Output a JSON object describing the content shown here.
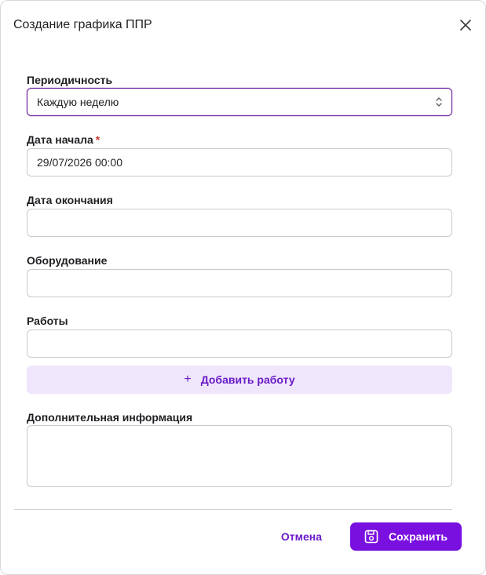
{
  "dialog": {
    "title": "Создание графика ППР",
    "close_icon": "close-icon"
  },
  "form": {
    "periodicity": {
      "label": "Периодичность",
      "value": "Каждую неделю",
      "icon": "chevron-up-down-icon"
    },
    "start_date": {
      "label": "Дата начала",
      "required_mark": "*",
      "value": "29/07/2026 00:00"
    },
    "end_date": {
      "label": "Дата окончания",
      "value": ""
    },
    "equipment": {
      "label": "Оборудование",
      "value": ""
    },
    "works": {
      "label": "Работы",
      "value": ""
    },
    "add_work": {
      "icon_glyph": "+",
      "label": "Добавить работу"
    },
    "additional_info": {
      "label": "Дополнительная информация",
      "value": ""
    }
  },
  "footer": {
    "cancel_label": "Отмена",
    "save_label": "Сохранить",
    "save_icon": "save-icon"
  },
  "colors": {
    "accent": "#7a10e0",
    "accent_text": "#6a1bc8",
    "accent_light": "#efe6fb",
    "required": "#d9342b"
  }
}
